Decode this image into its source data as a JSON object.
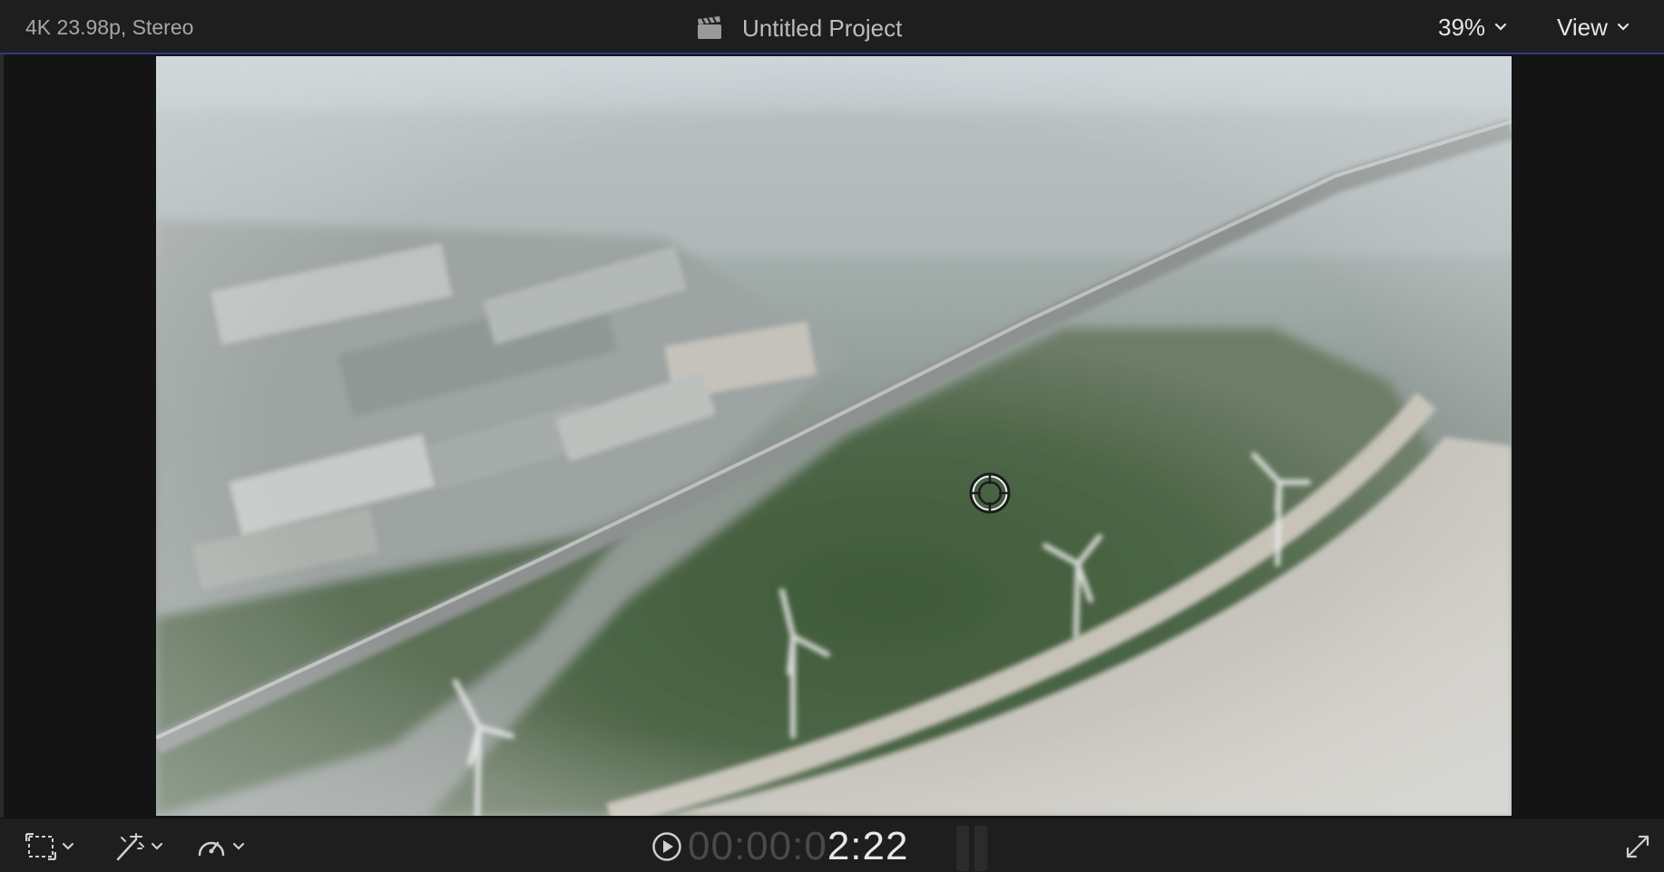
{
  "topbar": {
    "format_label": "4K 23.98p, Stereo",
    "project_title": "Untitled Project",
    "zoom_label": "39%",
    "view_label": "View"
  },
  "timecode": {
    "dim": "00:00:0",
    "bright": "2:22"
  },
  "icons": {
    "project": "clapperboard-icon",
    "zoom_menu": "chevron-down-icon",
    "view_menu": "chevron-down-icon",
    "transform": "transform-crop-icon",
    "enhance": "magic-wand-icon",
    "retime": "speedometer-icon",
    "play": "play-circle-icon",
    "fullscreen": "fullscreen-icon",
    "onscreen_control": "crosshair-target-icon"
  },
  "colors": {
    "accent_line": "#2f3a8a",
    "background": "#1a1a1a",
    "text_bright": "#e8e8e8",
    "text_dim": "#4a4a4a"
  }
}
